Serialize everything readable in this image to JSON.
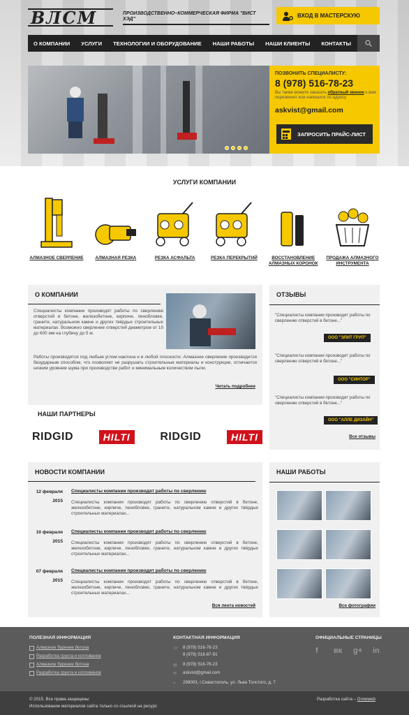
{
  "header": {
    "logo": "ВЛСМ",
    "tagline": "ПРОИЗВОДСТВЕННО–КОММЕРЧЕСКАЯ ФИРМА \"ВИСТ ХЭД\"",
    "workshop_btn": "ВХОД В МАСТЕРСКУЮ"
  },
  "nav": [
    "О КОМПАНИИ",
    "УСЛУГИ",
    "ТЕХНОЛОГИИ И ОБОРУДОВАНИЕ",
    "НАШИ РАБОТЫ",
    "НАШИ КЛИЕНТЫ",
    "КОНТАКТЫ"
  ],
  "call": {
    "label": "ПОЗВОНИТЬ СПЕЦИАЛИСТУ:",
    "phone": "8 (978) 516-78-23",
    "note_pre": "Вы также можете заказать",
    "note_link": "обратный звонок",
    "note_post": "и вам перезвонит или напишите по адресу",
    "email": "askvist@gmail.com",
    "price_btn": "ЗАПРОСИТЬ ПРАЙС-ЛИСТ"
  },
  "services": {
    "title": "УСЛУГИ КОМПАНИИ",
    "items": [
      "АЛМАЗНОЕ СВЕРЛЕНИЕ",
      "АЛМАЗНАЯ РЕЗКА",
      "РЕЗКА АСФАЛЬТА",
      "РЕЗКА ПЕРЕКРЫТИЙ",
      "ВОССТАНОВЛЕНИЕ АЛМАЗНЫХ КОРОНОК",
      "ПРОДАЖА АЛМАЗНОГО ИНСТРУМЕНТА"
    ]
  },
  "about": {
    "title": "О КОМПАНИИ",
    "p1": "Специалисты компании производят работы по сверлению отверстий в бетоне, железобетоне, кирпиче, пенобловке, граните, натуральном камне и других твёрдых строительных материалах. Возможно сверление отверстий диаметром от 10 до 600 мм на глубину до 5 м.",
    "p2": "Работы производятся под любым углом наклона и в любой плоскости. Алмазное сверление производится безударным способом, что позволяет не разрушать строительные материалы и конструкции, отличается низким уровнем шума при производстве работ и минимальным количеством пыли.",
    "more": "Читать подробнее"
  },
  "partners": {
    "title": "НАШИ ПАРТНЕРЫ",
    "logos": [
      "RIDGID",
      "HILTI",
      "RIDGID",
      "HILTI"
    ]
  },
  "reviews": {
    "title": "ОТЗЫВЫ",
    "items": [
      {
        "text": "\"Специалисты компании производят работы по сверлению отверстий в бетоне...\"",
        "author": "ООО \"ЭЛИТ ГРУП\""
      },
      {
        "text": "\"Специалисты компании производят работы по сверлению отверстий в бетоне...\"",
        "author": "ООО \"СИНТОР\""
      },
      {
        "text": "\"Специалисты компании производят работы по сверлению отверстий в бетоне...\"",
        "author": "ООО \"АЛЛЕ ДИЗАЙН\""
      }
    ],
    "all": "Все отзывы"
  },
  "news": {
    "title": "НОВОСТИ КОМПАНИИ",
    "items": [
      {
        "day": "12 февраля",
        "year": "2015",
        "headline": "Специалисты компании производят работы по сверлению",
        "text": "Специалисты компании производят работы по сверлению отверстий в бетоне, железобетоне, кирпиче, пенобловке, граните, натуральном камне и других твёрдых строительных материалах..."
      },
      {
        "day": "10 февраля",
        "year": "2015",
        "headline": "Специалисты компании производят работы по сверлению",
        "text": "Специалисты компании производят работы по сверлению отверстий в бетоне, железобетоне, кирпиче, пенобловке, граните, натуральном камне и других твёрдых строительных материалах..."
      },
      {
        "day": "07 февраля",
        "year": "2015",
        "headline": "Специалисты компании производят работы по сверлению",
        "text": "Специалисты компании производят работы по сверлению отверстий в бетоне, железобетоне, кирпиче, пенобловке, граните, натуральном камне и других твёрдых строительных материалах..."
      }
    ],
    "all": "Вся лента новостей"
  },
  "works": {
    "title": "НАШИ РАБОТЫ",
    "all": "Все фотографии"
  },
  "footer": {
    "useful_title": "ПОЛЕЗНАЯ ИНФОРМАЦИЯ",
    "links": [
      "Алмазное бурение бетона",
      "Разработка грунта и котлованов",
      "Алмазное бурение бетона",
      "Разработка грунта и котлованов"
    ],
    "contacts_title": "КОНТАКТНАЯ ИНФОРМАЦИЯ",
    "phones": [
      "8 (978) 516-78-23",
      "8 (978) 516-87-91"
    ],
    "fax": "8 (978) 516-78-23",
    "email": "askvist@gmail.com",
    "address": "299003, г.Севастополь, ул. Льва Толстого, д. 7",
    "social_title": "ОФИЦИАЛЬНЫЕ СТРАНИЦЫ",
    "social": [
      "f",
      "вк",
      "g+",
      "in"
    ],
    "copyright": "© 2015. Все права защищены",
    "copy_note": "Использование материалов сайта только со ссылкой на ресурс",
    "dev_label": "Разработка сайта –",
    "dev_link": "Growweb"
  },
  "colors": {
    "accent": "#f5c800",
    "dark": "#222222"
  }
}
